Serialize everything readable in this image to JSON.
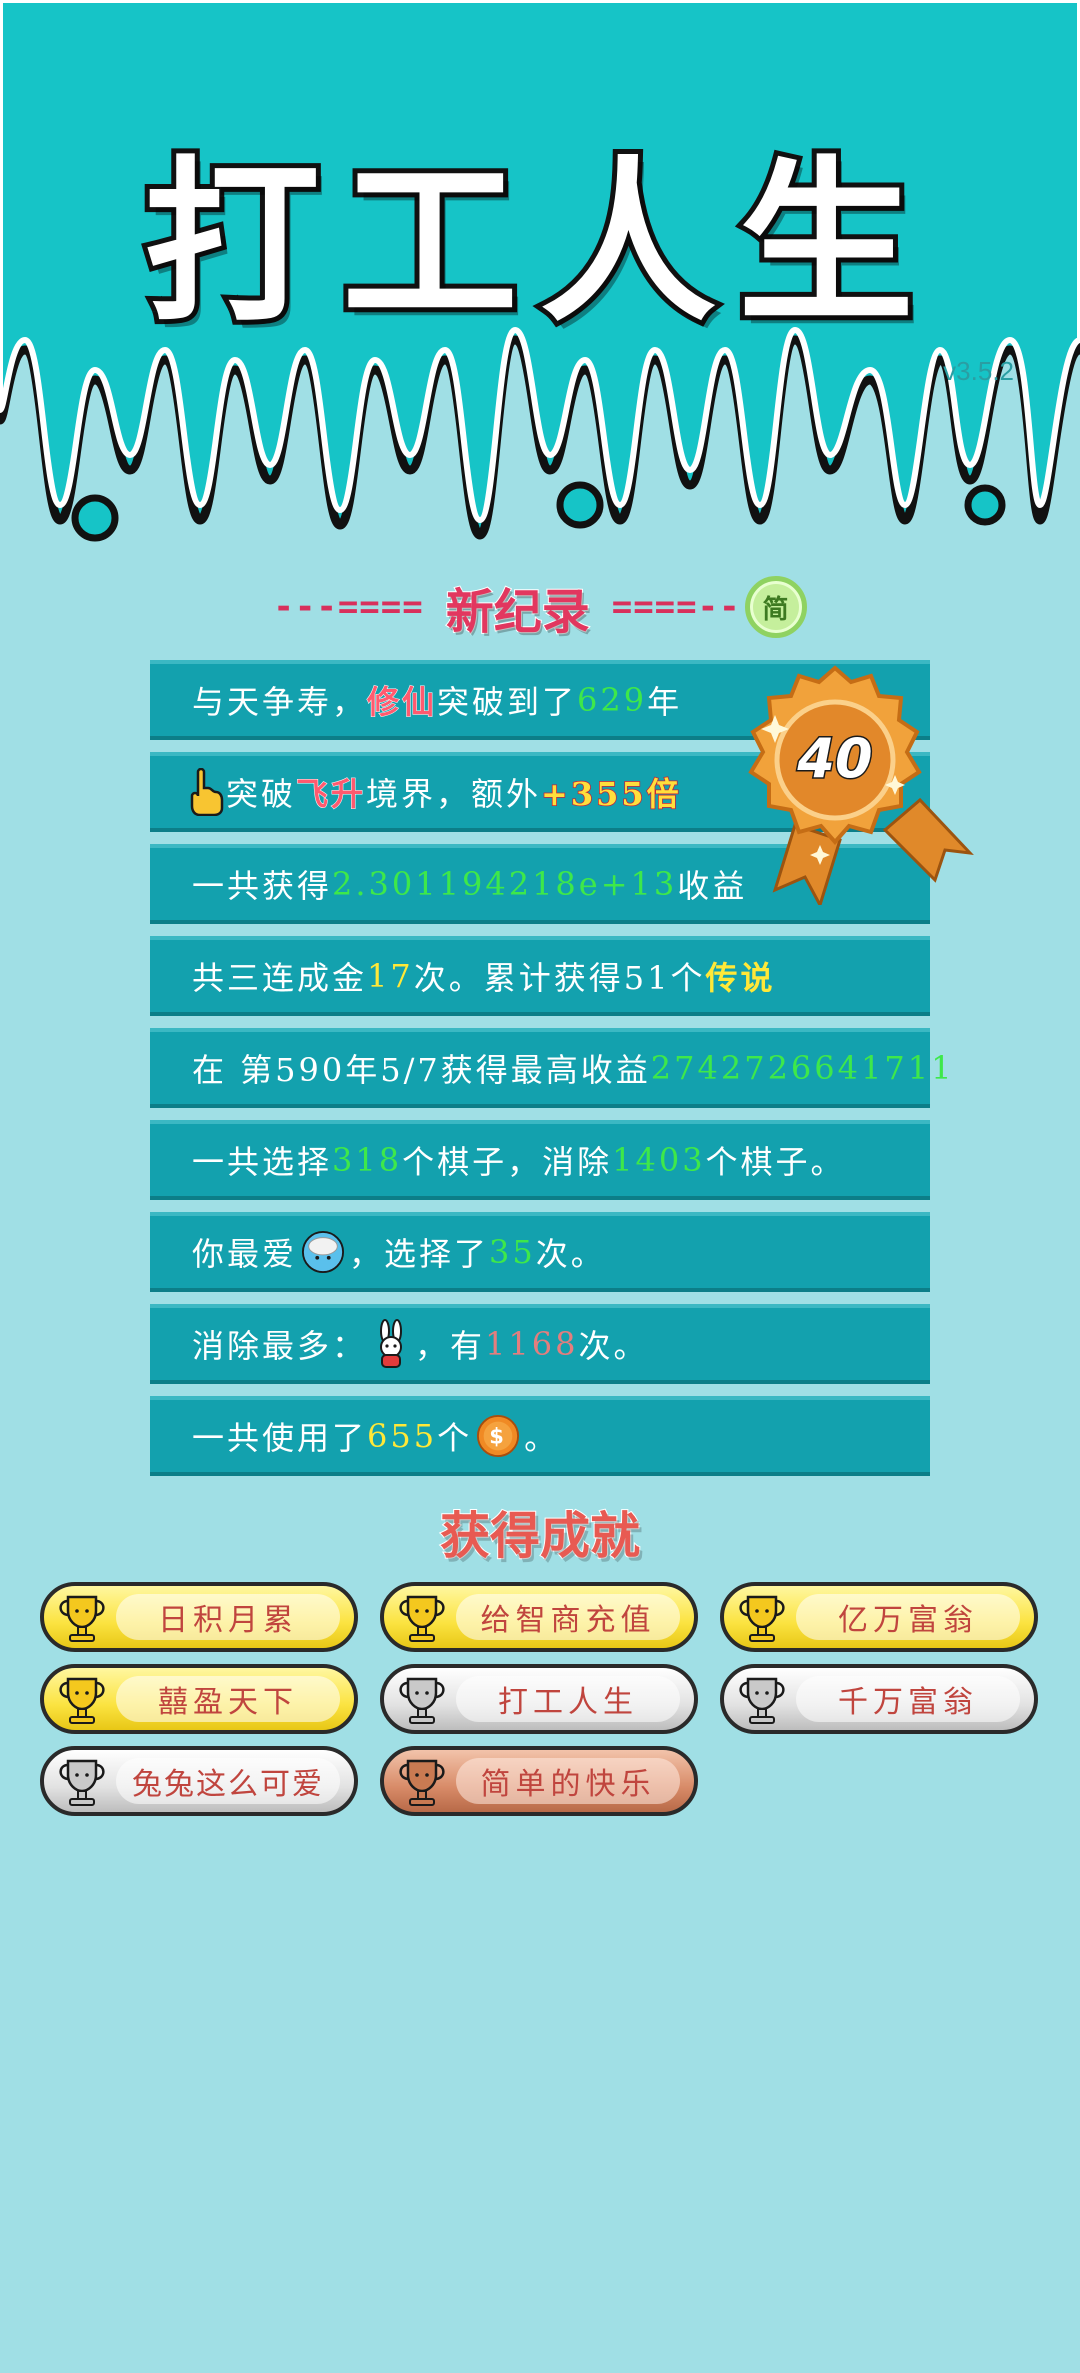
{
  "header": {
    "title": "打工人生",
    "version": "v3.5.2"
  },
  "record": {
    "dashes_left": "---====",
    "title": "新纪录",
    "dashes_right": "====--",
    "toggle_label": "简",
    "medal_number": "40"
  },
  "stats": {
    "row1": {
      "a": "与天争寿，",
      "b": "修仙",
      "c": "突破到了",
      "d": "629",
      "e": "年"
    },
    "row2": {
      "a": "突破",
      "b": "飞升",
      "c": "境界，额外",
      "d": "+355倍"
    },
    "row3": {
      "a": "一共获得",
      "b": "2.301194218e+13",
      "c": "收益"
    },
    "row4": {
      "a": "共三连成金",
      "b": "17",
      "c": "次。累计获得51个",
      "d": "传说"
    },
    "row5": {
      "a": "在 第590年5/7获得最高收益",
      "b": "2742726641711"
    },
    "row6": {
      "a": "一共选择",
      "b": "318",
      "c": "个棋子，消除",
      "d": "1403",
      "e": "个棋子。"
    },
    "row7": {
      "a": "你最爱",
      "b": "，选择了",
      "c": "35",
      "d": "次。"
    },
    "row8": {
      "a": "消除最多：",
      "b": "，有",
      "c": "1168",
      "d": "次。"
    },
    "row9": {
      "a": "一共使用了",
      "b": "655",
      "c": "个",
      "d": "。"
    }
  },
  "achievements": {
    "title": "获得成就",
    "items": [
      {
        "label": "日积月累",
        "tier": "gold"
      },
      {
        "label": "给智商充值",
        "tier": "gold"
      },
      {
        "label": "亿万富翁",
        "tier": "gold"
      },
      {
        "label": "囍盈天下",
        "tier": "gold"
      },
      {
        "label": "打工人生",
        "tier": "silver"
      },
      {
        "label": "千万富翁",
        "tier": "silver"
      },
      {
        "label": "兔兔这么可爱",
        "tier": "silver"
      },
      {
        "label": "简单的快乐",
        "tier": "bronze"
      }
    ]
  },
  "colors": {
    "header_bg": "#16c4c7",
    "page_bg": "#a0dfe5",
    "row_bg": "#13a1ae",
    "highlight_green": "#3ee84a",
    "highlight_yellow": "#ffe838"
  }
}
